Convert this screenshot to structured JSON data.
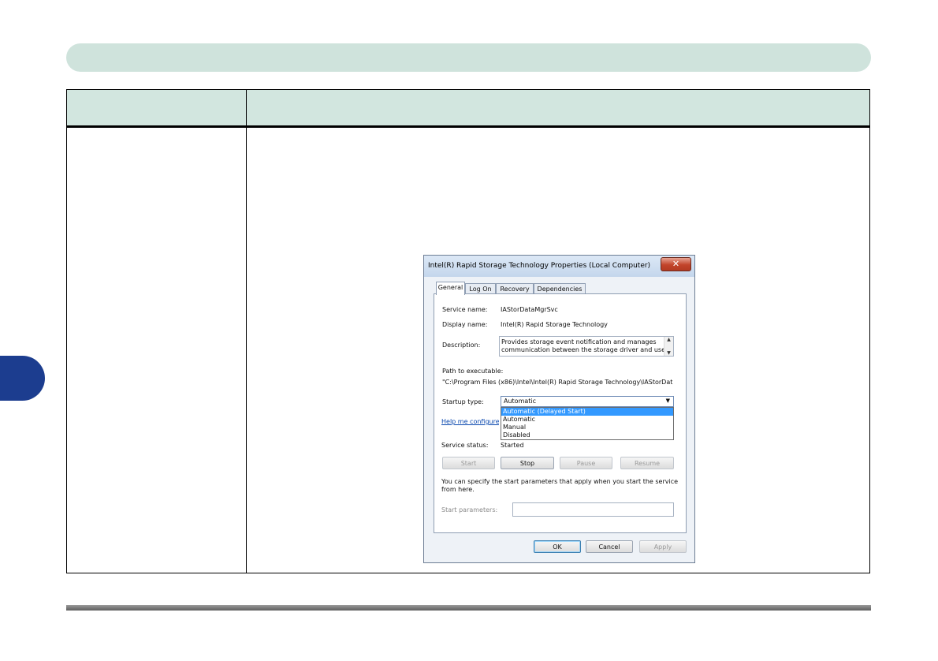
{
  "dialog": {
    "title": "Intel(R) Rapid Storage Technology Properties (Local Computer)",
    "close_glyph": "✕",
    "tabs": [
      "General",
      "Log On",
      "Recovery",
      "Dependencies"
    ],
    "service_name_label": "Service name:",
    "service_name_value": "IAStorDataMgrSvc",
    "display_name_label": "Display name:",
    "display_name_value": "Intel(R) Rapid Storage Technology",
    "description_label": "Description:",
    "description_line1": "Provides storage event notification and manages",
    "description_line2": "communication between the storage driver and user",
    "path_label": "Path to executable:",
    "path_value": "\"C:\\Program Files (x86)\\Intel\\Intel(R) Rapid Storage Technology\\IAStorDat",
    "startup_type_label": "Startup type:",
    "startup_type_value": "Automatic",
    "startup_options": [
      "Automatic (Delayed Start)",
      "Automatic",
      "Manual",
      "Disabled"
    ],
    "help_link": "Help me configure",
    "service_status_label": "Service status:",
    "service_status_value": "Started",
    "buttons": {
      "start": "Start",
      "stop": "Stop",
      "pause": "Pause",
      "resume": "Resume"
    },
    "params_hint_line1": "You can specify the start parameters that apply when you start the service",
    "params_hint_line2": "from here.",
    "start_params_label": "Start parameters:",
    "start_params_value": "",
    "footer_buttons": {
      "ok": "OK",
      "cancel": "Cancel",
      "apply": "Apply"
    }
  },
  "colors": {
    "header_band": "#cfe3dc",
    "side_tab": "#1c3d8f",
    "selection": "#3399ff"
  }
}
